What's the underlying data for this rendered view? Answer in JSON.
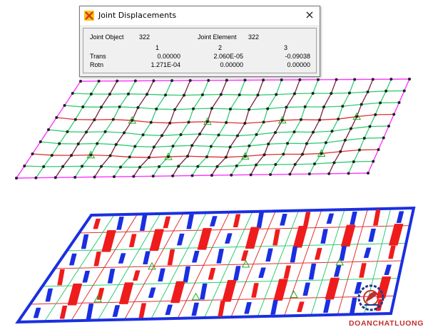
{
  "dialog": {
    "title": "Joint Displacements",
    "close_glyph": "×",
    "joint_object_label": "Joint Object",
    "joint_object_value": "322",
    "joint_element_label": "Joint Element",
    "joint_element_value": "322",
    "columns": [
      "1",
      "2",
      "3"
    ],
    "rows": [
      {
        "label": "Trans",
        "values": [
          "0.00000",
          "2.060E-05",
          "-0.09038"
        ]
      },
      {
        "label": "Rotn",
        "values": [
          "1.271E-04",
          "0.00000",
          "0.00000"
        ]
      }
    ]
  },
  "watermark": {
    "text": "DOANCHATLUONG.VN",
    "logo_icon": "gear-leaf-logo"
  },
  "colors": {
    "mesh_green": "#2ecc71",
    "mesh_red": "#e03030",
    "mesh_maroon": "#7a1f3a",
    "mesh_edge": "#ff33ff",
    "node": "#222222",
    "support": "#22aa22",
    "diagram_blue": "#1a2fe0",
    "diagram_red": "#ee1c1c",
    "watermark": "#c0302c"
  }
}
